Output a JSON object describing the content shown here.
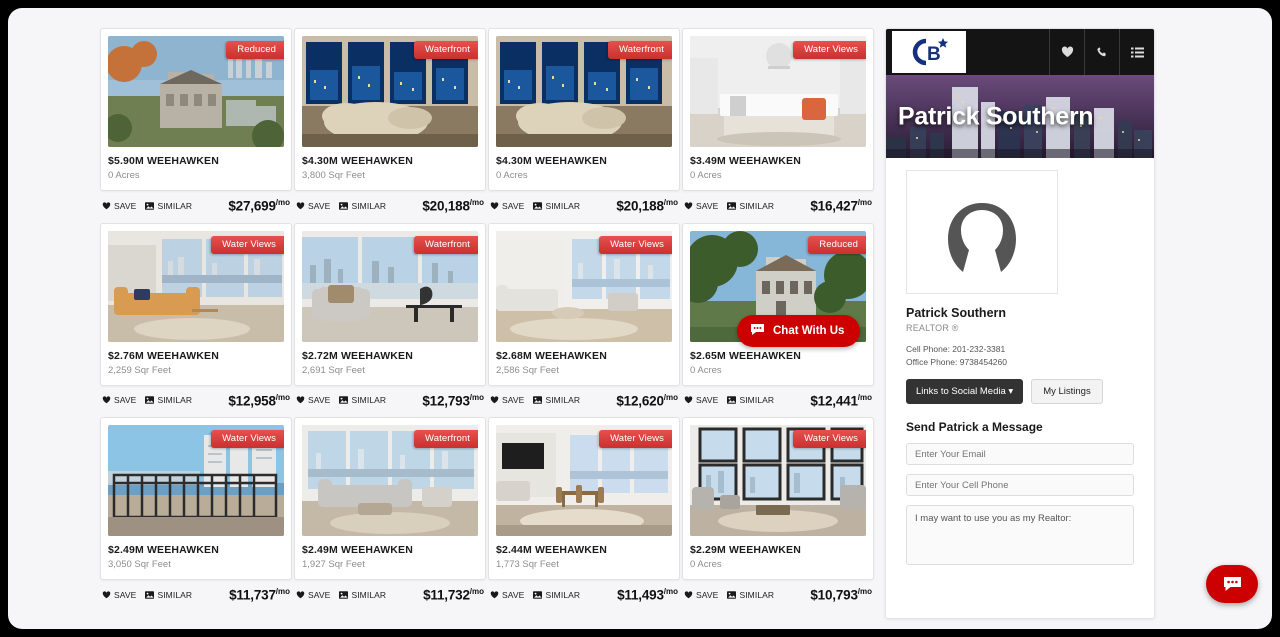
{
  "colors": {
    "badge_red": "#c8312f",
    "chat_red": "#cc0000",
    "nav_black": "#141414",
    "page_bg": "#f6f6f8"
  },
  "listings": [
    {
      "badge": "Reduced",
      "price_title": "$5.90M WEEHAWKEN",
      "detail": "0 Acres",
      "save": "SAVE",
      "similar": "SIMILAR",
      "monthly": "$27,699",
      "per": "/mo",
      "scene": "mansion-river"
    },
    {
      "badge": "Waterfront",
      "price_title": "$4.30M WEEHAWKEN",
      "detail": "3,800 Sqr Feet",
      "save": "SAVE",
      "similar": "SIMILAR",
      "monthly": "$20,188",
      "per": "/mo",
      "scene": "night-window-sofa"
    },
    {
      "badge": "Waterfront",
      "price_title": "$4.30M WEEHAWKEN",
      "detail": "0 Acres",
      "save": "SAVE",
      "similar": "SIMILAR",
      "monthly": "$20,188",
      "per": "/mo",
      "scene": "night-window-sofa"
    },
    {
      "badge": "Water Views",
      "price_title": "$3.49M WEEHAWKEN",
      "detail": "0 Acres",
      "save": "SAVE",
      "similar": "SIMILAR",
      "monthly": "$16,427",
      "per": "/mo",
      "scene": "white-kitchen"
    },
    {
      "badge": "Water Views",
      "price_title": "$2.76M WEEHAWKEN",
      "detail": "2,259 Sqr Feet",
      "save": "SAVE",
      "similar": "SIMILAR",
      "monthly": "$12,958",
      "per": "/mo",
      "scene": "tan-sofa-corner"
    },
    {
      "badge": "Waterfront",
      "price_title": "$2.72M WEEHAWKEN",
      "detail": "2,691 Sqr Feet",
      "save": "SAVE",
      "similar": "SIMILAR",
      "monthly": "$12,793",
      "per": "/mo",
      "scene": "grey-chair-skyline"
    },
    {
      "badge": "Water Views",
      "price_title": "$2.68M WEEHAWKEN",
      "detail": "2,586 Sqr Feet",
      "save": "SAVE",
      "similar": "SIMILAR",
      "monthly": "$12,620",
      "per": "/mo",
      "scene": "bright-living"
    },
    {
      "badge": "Reduced",
      "price_title": "$2.65M WEEHAWKEN",
      "detail": "0 Acres",
      "save": "SAVE",
      "similar": "SIMILAR",
      "monthly": "$12,441",
      "per": "/mo",
      "scene": "victorian-tree"
    },
    {
      "badge": "Water Views",
      "price_title": "$2.49M WEEHAWKEN",
      "detail": "3,050 Sqr Feet",
      "save": "SAVE",
      "similar": "SIMILAR",
      "monthly": "$11,737",
      "per": "/mo",
      "scene": "balcony-view"
    },
    {
      "badge": "Waterfront",
      "price_title": "$2.49M WEEHAWKEN",
      "detail": "1,927 Sqr Feet",
      "save": "SAVE",
      "similar": "SIMILAR",
      "monthly": "$11,732",
      "per": "/mo",
      "scene": "grey-sofa-window"
    },
    {
      "badge": "Water Views",
      "price_title": "$2.44M WEEHAWKEN",
      "detail": "1,773 Sqr Feet",
      "save": "SAVE",
      "similar": "SIMILAR",
      "monthly": "$11,493",
      "per": "/mo",
      "scene": "dining-open"
    },
    {
      "badge": "Water Views",
      "price_title": "$2.29M WEEHAWKEN",
      "detail": "0 Acres",
      "save": "SAVE",
      "similar": "SIMILAR",
      "monthly": "$10,793",
      "per": "/mo",
      "scene": "tall-windows"
    }
  ],
  "chat_widget": {
    "label": "Chat With Us"
  },
  "sidebar": {
    "logo_text": "CB",
    "nav_icons": [
      "heart-icon",
      "phone-icon",
      "list-icon"
    ],
    "banner_name": "Patrick Southern",
    "agent": {
      "name": "Patrick Southern",
      "role": "REALTOR ®",
      "cell_phone": "Cell Phone: 201-232-3381",
      "office_phone": "Office Phone: 9738454260",
      "social_button": "Links to Social Media",
      "social_caret": "▾",
      "listings_button": "My Listings"
    },
    "form": {
      "title": "Send Patrick a Message",
      "email_placeholder": "Enter Your Email",
      "phone_placeholder": "Enter Your Cell Phone",
      "message_value": "I may want to use you as my Realtor:"
    }
  }
}
